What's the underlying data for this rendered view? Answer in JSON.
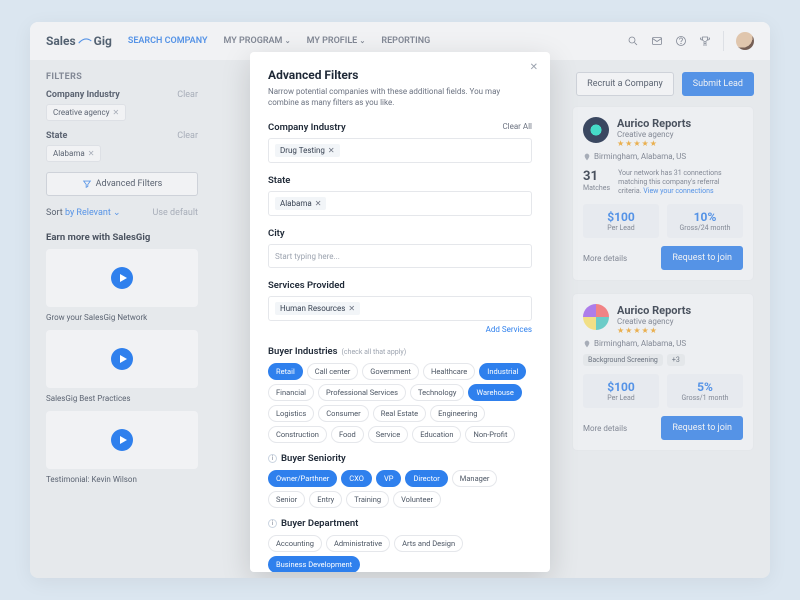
{
  "nav": {
    "logo_a": "Sales",
    "logo_b": "Gig",
    "items": [
      "SEARCH COMPANY",
      "MY PROGRAM",
      "MY PROFILE",
      "REPORTING"
    ]
  },
  "sidebar": {
    "title": "FILTERS",
    "clear": "Clear",
    "industry_label": "Company Industry",
    "industry_chip": "Creative agency",
    "state_label": "State",
    "state_chip": "Alabama",
    "advanced": "Advanced Filters",
    "sort_label": "Sort",
    "sort_value": "by Relevant",
    "sort_default": "Use default",
    "earn_title": "Earn more with SalesGig",
    "promos": [
      "Grow your SalesGig Network",
      "SalesGig Best Practices",
      "Testimonial: Kevin Wilson"
    ]
  },
  "toolbar": {
    "recruit": "Recruit a Company",
    "submit": "Submit Lead"
  },
  "cards": [
    {
      "name": "Aurico Reports",
      "sub": "Creative agency",
      "loc": "Birmingham, Alabama, US",
      "matches_n": "31",
      "matches_l": "Matches",
      "matches_text": "Your network has 31 connections matching this company's referral criteria.",
      "matches_link": "View your connections",
      "m1v": "$100",
      "m1l": "Per Lead",
      "m2v": "10%",
      "m2l": "Gross/24 month",
      "more": "More details",
      "cta": "Request to join"
    },
    {
      "name": "Aurico Reports",
      "sub": "Creative agency",
      "loc": "Birmingham, Alabama, US",
      "tag1": "Background Screening",
      "tag2": "+3",
      "m1v": "$100",
      "m1l": "Per Lead",
      "m2v": "5%",
      "m2l": "Gross/1 month",
      "more": "More details",
      "cta": "Request to join"
    }
  ],
  "modal": {
    "title": "Advanced Filters",
    "sub": "Narrow potential companies with these additional fields.  You may combine as many filters as you like.",
    "clear_all": "Clear All",
    "industry_label": "Company Industry",
    "industry_chip": "Drug Testing",
    "state_label": "State",
    "state_chip": "Alabama",
    "city_label": "City",
    "city_placeholder": "Start typing here...",
    "services_label": "Services Provided",
    "services_chip": "Human Resources",
    "add_services": "Add Services",
    "buyer_ind_label": "Buyer Industries",
    "buyer_ind_hint": "(check all that apply)",
    "buyer_ind": [
      "Retail",
      "Call center",
      "Government",
      "Healthcare",
      "Industrial",
      "Financial",
      "Professional Services",
      "Technology",
      "Warehouse",
      "Logistics",
      "Consumer",
      "Real Estate",
      "Engineering",
      "Construction",
      "Food",
      "Service",
      "Education",
      "Non-Profit"
    ],
    "buyer_ind_on": [
      0,
      4,
      8
    ],
    "seniority_label": "Buyer Seniority",
    "seniority": [
      "Owner/Parthner",
      "CXO",
      "VP",
      "Director",
      "Manager",
      "Senior",
      "Entry",
      "Training",
      "Volunteer"
    ],
    "seniority_on": [
      0,
      1,
      2,
      3
    ],
    "dept_label": "Buyer Department",
    "dept": [
      "Accounting",
      "Administrative",
      "Arts and Design",
      "Business Development"
    ],
    "dept_on": [
      3
    ]
  }
}
